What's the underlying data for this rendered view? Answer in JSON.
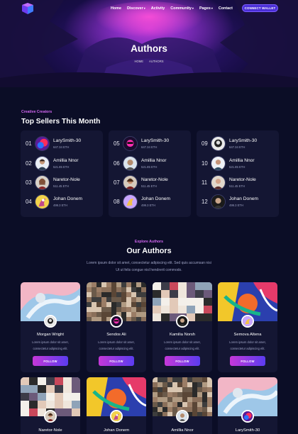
{
  "nav": {
    "items": [
      "Home",
      "Discover",
      "Activity",
      "Community",
      "Pages",
      "Contact"
    ],
    "dropdown_flags": [
      false,
      true,
      false,
      true,
      true,
      false
    ],
    "connect_label": "CONNECT WALLET"
  },
  "hero": {
    "title": "Authors",
    "breadcrumb": [
      "HOME",
      "AUTHORS"
    ]
  },
  "top_sellers": {
    "kicker": "Creative Creators",
    "title": "Top Sellers This Month",
    "sellers": [
      {
        "rank": "01",
        "name": "LarySmith-30",
        "eth": "647.34 ETH"
      },
      {
        "rank": "02",
        "name": "Amillia Nnor",
        "eth": "521.85 ETH"
      },
      {
        "rank": "03",
        "name": "Naretor-Nole",
        "eth": "511.45 ETH"
      },
      {
        "rank": "04",
        "name": "Johan Donem",
        "eth": "499.3 ETH"
      },
      {
        "rank": "05",
        "name": "LarySmith-30",
        "eth": "647.34 ETH"
      },
      {
        "rank": "06",
        "name": "Amillia Nnor",
        "eth": "521.85 ETH"
      },
      {
        "rank": "07",
        "name": "Naretor-Nole",
        "eth": "511.45 ETH"
      },
      {
        "rank": "08",
        "name": "Johan Donem",
        "eth": "499.3 ETH"
      },
      {
        "rank": "09",
        "name": "LarySmith-30",
        "eth": "647.34 ETH"
      },
      {
        "rank": "10",
        "name": "Amillia Nnor",
        "eth": "521.85 ETH"
      },
      {
        "rank": "11",
        "name": "Naretor-Nole",
        "eth": "511.45 ETH"
      },
      {
        "rank": "12",
        "name": "Johan Donem",
        "eth": "499.3 ETH"
      }
    ]
  },
  "authors": {
    "kicker": "Explore Authors",
    "title": "Our Authors",
    "description": "Lorem ipsum dolor sit amet, consectetur adipiscing elit. Sed quis accumsan nisi Ut ut felis congue nisl hendrerit commodo.",
    "card_text": "Lorem ipsum dolor sit amet, consectetur adipiscing elit.",
    "follow_label": "FOLLOW",
    "row1": [
      "Morgan Wright",
      "Sendos Ali",
      "Kamilia Norsh",
      "Semova Altena"
    ],
    "row2": [
      "Naretor-Nole",
      "Johan Donem",
      "Amillia Nnor",
      "LarySmith-30"
    ]
  },
  "colors": {
    "background": "#0b0d26",
    "card": "#141633",
    "accent_pink": "#d166f0",
    "accent_blue": "#4b2fd8"
  }
}
